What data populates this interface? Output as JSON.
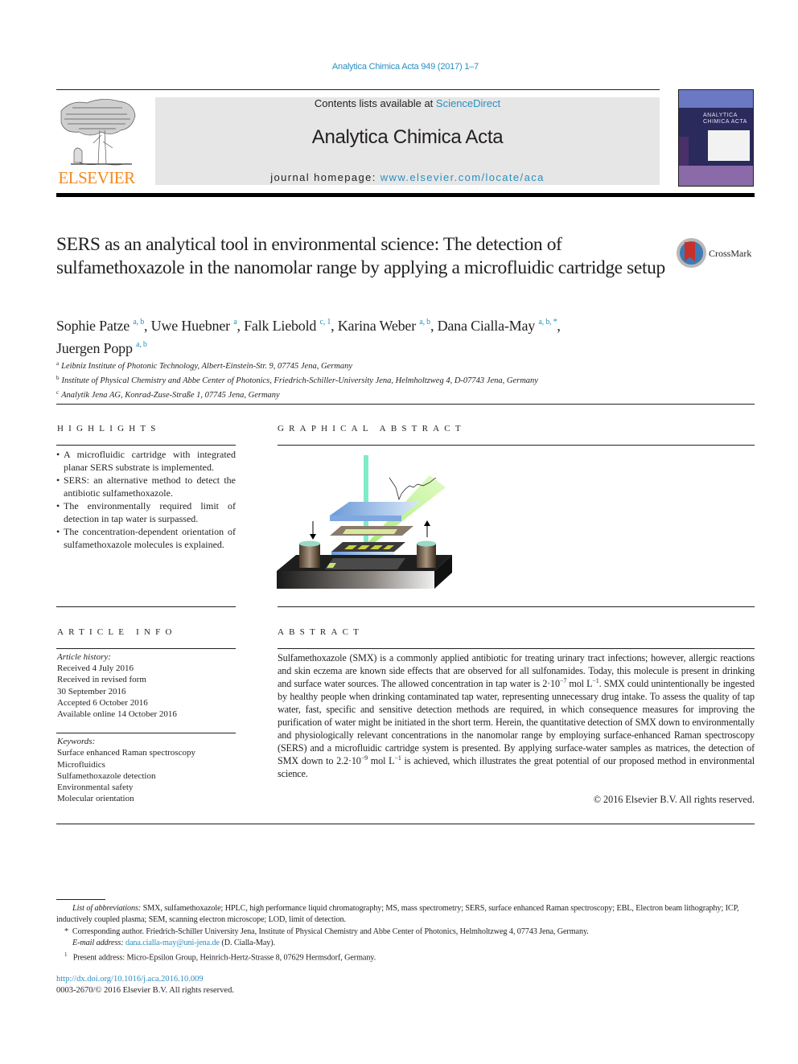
{
  "header": {
    "journal_reference": "Analytica Chimica Acta 949 (2017) 1–7",
    "contents_prefix": "Contents lists available at ",
    "contents_link": "ScienceDirect",
    "journal_title": "Analytica Chimica Acta",
    "homepage_prefix": "journal homepage: ",
    "homepage_link": "www.elsevier.com/locate/aca",
    "publisher_logo_text": "ELSEVIER",
    "cover_title_line1": "ANALYTICA",
    "cover_title_line2": "CHIMICA ACTA",
    "crossmark_label": "CrossMark"
  },
  "article": {
    "title": "SERS as an analytical tool in environmental science: The detection of sulfamethoxazole in the nanomolar range by applying a microfluidic cartridge setup",
    "authors": [
      {
        "name": "Sophie Patze",
        "sup": "a, b",
        "sep": ", "
      },
      {
        "name": "Uwe Huebner",
        "sup": "a",
        "sep": ", "
      },
      {
        "name": "Falk Liebold",
        "sup": "c, 1",
        "sep": ", "
      },
      {
        "name": "Karina Weber",
        "sup": "a, b",
        "sep": ", "
      },
      {
        "name": "Dana Cialla-May",
        "sup": "a, b, *",
        "sep": ","
      },
      {
        "name": "Juergen Popp",
        "sup": "a, b",
        "sep": ""
      }
    ],
    "affiliations": [
      {
        "key": "a",
        "text": "Leibniz Institute of Photonic Technology, Albert-Einstein-Str. 9, 07745 Jena, Germany"
      },
      {
        "key": "b",
        "text": "Institute of Physical Chemistry and Abbe Center of Photonics, Friedrich-Schiller-University Jena, Helmholtzweg 4, D-07743 Jena, Germany"
      },
      {
        "key": "c",
        "text": "Analytik Jena AG, Konrad-Zuse-Straße 1, 07745 Jena, Germany"
      }
    ]
  },
  "highlights": {
    "heading": "HIGHLIGHTS",
    "items": [
      "A microfluidic cartridge with integrated planar SERS substrate is implemented.",
      "SERS: an alternative method to detect the antibiotic sulfamethoxazole.",
      "The environmentally required limit of detection in tap water is surpassed.",
      "The concentration-dependent orientation of sulfamethoxazole molecules is explained."
    ]
  },
  "graphical_abstract": {
    "heading": "GRAPHICAL ABSTRACT"
  },
  "article_info": {
    "heading": "ARTICLE INFO",
    "history_label": "Article history:",
    "history": [
      "Received 4 July 2016",
      "Received in revised form",
      "30 September 2016",
      "Accepted 6 October 2016",
      "Available online 14 October 2016"
    ],
    "keywords_label": "Keywords:",
    "keywords": [
      "Surface enhanced Raman spectroscopy",
      "Microfluidics",
      "Sulfamethoxazole detection",
      "Environmental safety",
      "Molecular orientation"
    ]
  },
  "abstract": {
    "heading": "ABSTRACT",
    "part1": "Sulfamethoxazole (SMX) is a commonly applied antibiotic for treating urinary tract infections; however, allergic reactions and skin eczema are known side effects that are observed for all sulfonamides. Today, this molecule is present in drinking and surface water sources. The allowed concentration in tap water is 2·10",
    "exp1": "−7",
    "part2": " mol L",
    "exp2": "−1",
    "part3": ". SMX could unintentionally be ingested by healthy people when drinking contaminated tap water, representing unnecessary drug intake. To assess the quality of tap water, fast, specific and sensitive detection methods are required, in which consequence measures for improving the purification of water might be initiated in the short term. Herein, the quantitative detection of SMX down to environmentally and physiologically relevant concentrations in the nanomolar range by employing surface-enhanced Raman spectroscopy (SERS) and a microfluidic cartridge system is presented. By applying surface-water samples as matrices, the detection of SMX down to 2.2·10",
    "exp3": "−9",
    "part4": " mol L",
    "exp4": "−1",
    "part5": " is achieved, which illustrates the great potential of our proposed method in environmental science.",
    "copyright": "© 2016 Elsevier B.V. All rights reserved."
  },
  "footnotes": {
    "abbrev_label": "List of abbreviations:",
    "abbrev_text": " SMX, sulfamethoxazole; HPLC, high performance liquid chromatography; MS, mass spectrometry; SERS, surface enhanced Raman spectroscopy; EBL, Electron beam lithography; ICP, inductively coupled plasma; SEM, scanning electron microscope; LOD, limit of detection.",
    "corresponding_mark": "*",
    "corresponding_text": "Corresponding author. Friedrich-Schiller University Jena, Institute of Physical Chemistry and Abbe Center of Photonics, Helmholtzweg 4, 07743 Jena, Germany.",
    "email_label": "E-mail address:",
    "email": "dana.cialla-may@uni-jena.de",
    "email_suffix": " (D. Cialla-May).",
    "present_mark": "1",
    "present_text": "Present address: Micro-Epsilon Group, Heinrich-Hertz-Strasse 8, 07629 Hermsdorf, Germany.",
    "doi": "http://dx.doi.org/10.1016/j.aca.2016.10.009",
    "issn": "0003-2670/© 2016 Elsevier B.V. All rights reserved."
  }
}
